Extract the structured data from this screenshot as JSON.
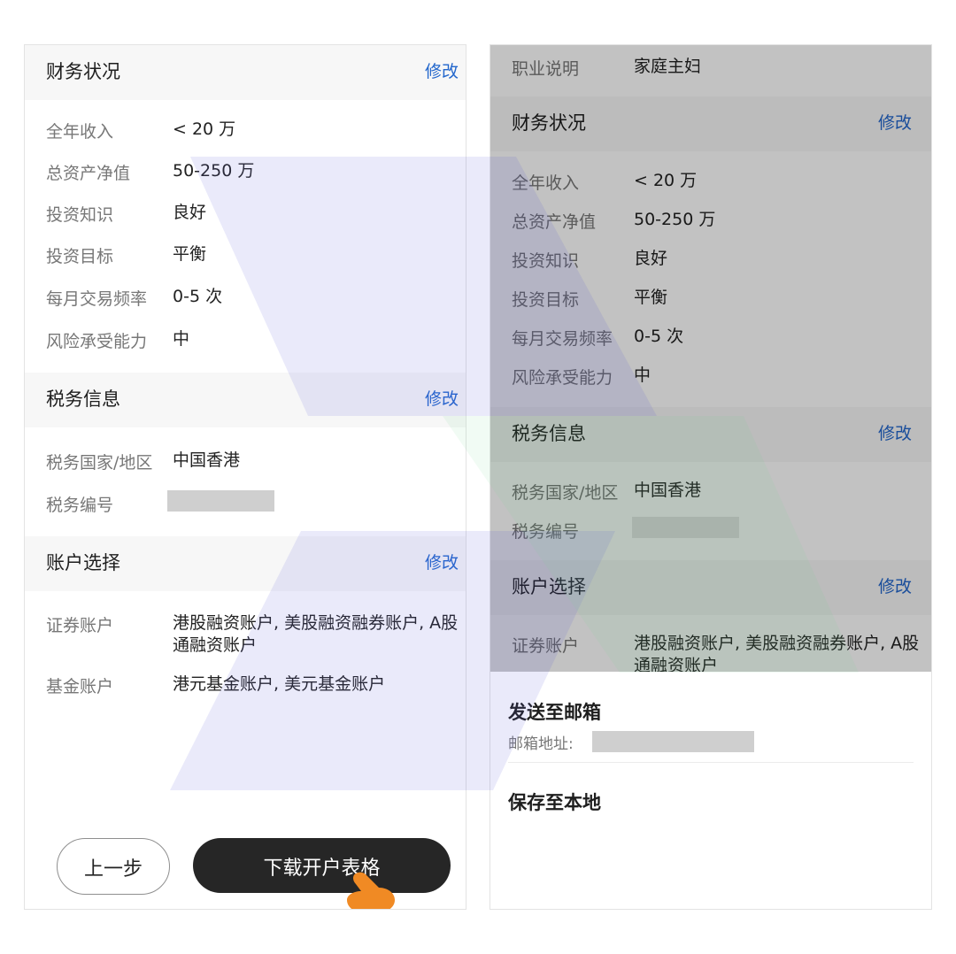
{
  "left": {
    "finance": {
      "title": "财务状况",
      "edit": "修改",
      "rows": [
        {
          "label": "全年收入",
          "value": "< 20 万"
        },
        {
          "label": "总资产净值",
          "value": "50-250 万"
        },
        {
          "label": "投资知识",
          "value": "良好"
        },
        {
          "label": "投资目标",
          "value": "平衡"
        },
        {
          "label": "每月交易频率",
          "value": "0-5 次"
        },
        {
          "label": "风险承受能力",
          "value": "中"
        }
      ]
    },
    "tax": {
      "title": "税务信息",
      "edit": "修改",
      "rows": [
        {
          "label": "税务国家/地区",
          "value": "中国香港"
        },
        {
          "label": "税务编号",
          "value": ""
        }
      ]
    },
    "account": {
      "title": "账户选择",
      "edit": "修改",
      "rows": [
        {
          "label": "证券账户",
          "value": "港股融资账户, 美股融资融券账户, A股通融资账户"
        },
        {
          "label": "基金账户",
          "value": "港元基金账户, 美元基金账户"
        }
      ]
    },
    "buttons": {
      "prev": "上一步",
      "download": "下载开户表格"
    }
  },
  "right": {
    "occupation": {
      "label": "职业说明",
      "value": "家庭主妇"
    },
    "finance": {
      "title": "财务状况",
      "edit": "修改",
      "rows": [
        {
          "label": "全年收入",
          "value": "< 20 万"
        },
        {
          "label": "总资产净值",
          "value": "50-250 万"
        },
        {
          "label": "投资知识",
          "value": "良好"
        },
        {
          "label": "投资目标",
          "value": "平衡"
        },
        {
          "label": "每月交易频率",
          "value": "0-5 次"
        },
        {
          "label": "风险承受能力",
          "value": "中"
        }
      ]
    },
    "tax": {
      "title": "税务信息",
      "edit": "修改",
      "rows": [
        {
          "label": "税务国家/地区",
          "value": "中国香港"
        },
        {
          "label": "税务编号",
          "value": ""
        }
      ]
    },
    "account": {
      "title": "账户选择",
      "edit": "修改",
      "rows": [
        {
          "label": "证券账户",
          "value": "港股融资账户, 美股融资融券账户, A股通融资账户"
        }
      ]
    },
    "sheet": {
      "send_title": "发送至邮箱",
      "email_label": "邮箱地址:",
      "save_title": "保存至本地"
    }
  },
  "colors": {
    "accent": "#2266cc",
    "primary_button": "#262626",
    "hand": "#f08a24"
  }
}
